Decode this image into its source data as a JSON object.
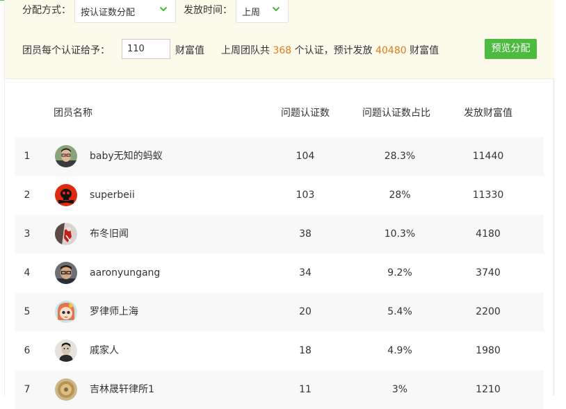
{
  "filter": {
    "method_label": "分配方式：",
    "method_value": "按认证数分配",
    "time_label": "发放时间：",
    "time_value": "上周",
    "per_cert_label": "团员每个认证给予：",
    "per_cert_value": "110",
    "unit_label": "财富值",
    "summary_prefix": "上周团队共",
    "summary_count": "368",
    "summary_mid": "个认证，预计发放",
    "summary_total": "40480",
    "summary_unit": "财富值",
    "preview_button": "预览分配"
  },
  "table": {
    "headers": {
      "name": "团员名称",
      "count": "问题认证数",
      "ratio": "问题认证数占比",
      "wealth": "发放财富值"
    },
    "rows": [
      {
        "rank": "1",
        "name": "baby无知的蚂蚁",
        "count": "104",
        "ratio": "28.3%",
        "wealth": "11440",
        "avatar": "avatar-man-glasses"
      },
      {
        "rank": "2",
        "name": "superbeii",
        "count": "103",
        "ratio": "28%",
        "wealth": "11330",
        "avatar": "avatar-skull-red"
      },
      {
        "rank": "3",
        "name": "布冬旧闻",
        "count": "38",
        "ratio": "10.3%",
        "wealth": "4180",
        "avatar": "avatar-figure-red"
      },
      {
        "rank": "4",
        "name": "aaronyungang",
        "count": "34",
        "ratio": "9.2%",
        "wealth": "3740",
        "avatar": "avatar-man-glasses-2"
      },
      {
        "rank": "5",
        "name": "罗律师上海",
        "count": "20",
        "ratio": "5.4%",
        "wealth": "2200",
        "avatar": "avatar-cartoon-girl"
      },
      {
        "rank": "6",
        "name": "戚家人",
        "count": "18",
        "ratio": "4.9%",
        "wealth": "1980",
        "avatar": "avatar-portrait-bw"
      },
      {
        "rank": "7",
        "name": "吉林晟轩律所1",
        "count": "11",
        "ratio": "3%",
        "wealth": "1210",
        "avatar": "avatar-seal"
      }
    ]
  },
  "colors": {
    "accent_green": "#4cbb3f",
    "highlight_orange": "#e07a1a",
    "filter_bg": "#fcfaea",
    "row_alt_bg": "#f8f8f8"
  }
}
